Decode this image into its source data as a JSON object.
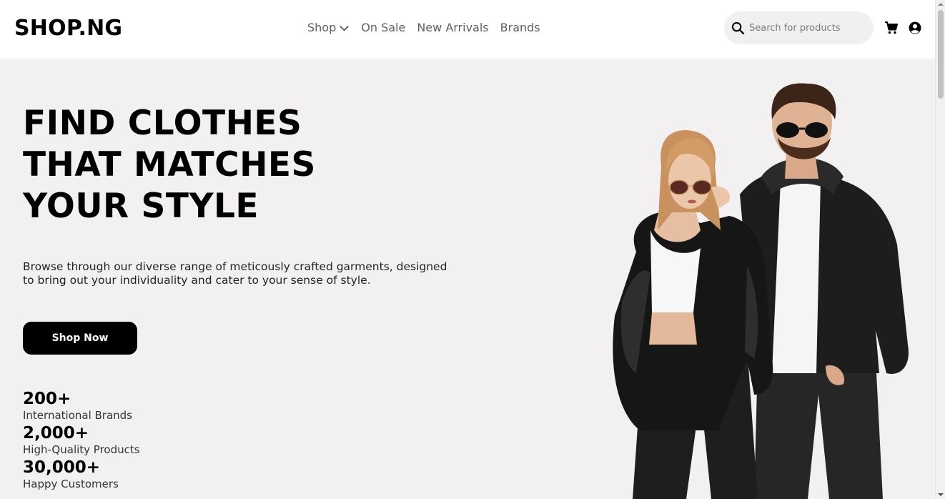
{
  "header": {
    "logo": "SHOP.NG",
    "nav": [
      {
        "label": "Shop",
        "has_dropdown": true
      },
      {
        "label": "On Sale"
      },
      {
        "label": "New Arrivals"
      },
      {
        "label": "Brands"
      }
    ],
    "search": {
      "placeholder": "Search for products",
      "value": ""
    },
    "icons": {
      "search": "search-icon",
      "cart": "cart-icon",
      "account": "user-circle-icon",
      "dropdown": "chevron-down-icon"
    }
  },
  "hero": {
    "headline_lines": [
      "FIND CLOTHES",
      "THAT MATCHES",
      "YOUR STYLE"
    ],
    "description_lines": [
      "Browse through our diverse range of meticously crafted garments, designed",
      "to bring out your individuality and cater to your sense of style."
    ],
    "cta_label": "Shop Now",
    "stats": [
      {
        "value": "200+",
        "label": "International Brands"
      },
      {
        "value": "2,000+",
        "label": "High-Quality Products"
      },
      {
        "value": "30,000+",
        "label": "Happy Customers"
      }
    ],
    "image": "couple-in-black-leather-jackets"
  },
  "colors": {
    "hero_bg": "#f2f0f1",
    "primary": "#000000",
    "nav_text": "#5f5f5f",
    "search_bg": "#f0f0f0"
  }
}
